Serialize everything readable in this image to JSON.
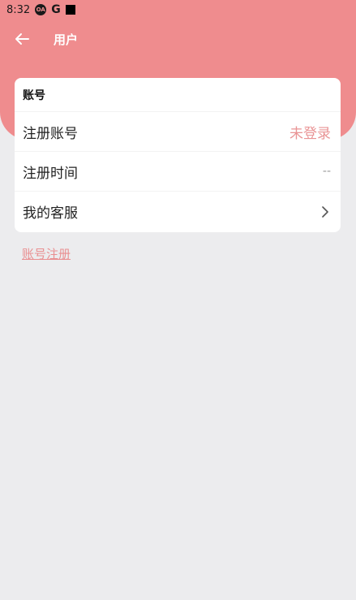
{
  "status_bar": {
    "time": "8:32",
    "icons": [
      "cloud-badge-icon",
      "google-icon",
      "square-icon"
    ],
    "g_label": "G",
    "badge_label": "OA"
  },
  "nav": {
    "title": "用户",
    "back_icon": "arrow-left-icon"
  },
  "account_card": {
    "header": "账号",
    "rows": [
      {
        "label": "注册账号",
        "value": "未登录"
      },
      {
        "label": "注册时间",
        "value": "--"
      },
      {
        "label": "我的客服",
        "value": "",
        "icon": "chevron-right-icon"
      }
    ]
  },
  "register_link": "账号注册",
  "colors": {
    "header_bg": "#ef8c8e",
    "page_bg": "#ececee",
    "accent_text": "#e99495"
  }
}
